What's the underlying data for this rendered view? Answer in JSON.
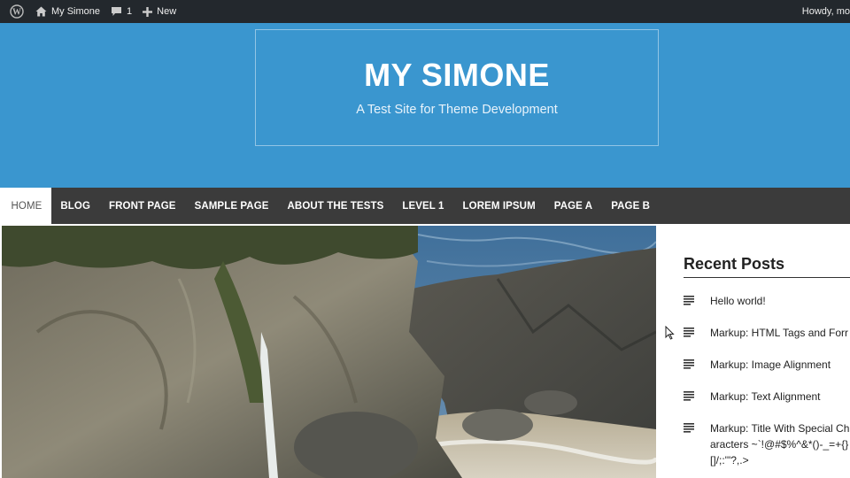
{
  "admin_bar": {
    "site_name": "My Simone",
    "comments_count": "1",
    "new_label": "New",
    "howdy": "Howdy, mo"
  },
  "header": {
    "site_title": "MY SIMONE",
    "tagline": "A Test Site for Theme Development",
    "background_color": "#3a96cf"
  },
  "nav": {
    "items": [
      {
        "label": "HOME",
        "active": true
      },
      {
        "label": "BLOG"
      },
      {
        "label": "FRONT PAGE"
      },
      {
        "label": "SAMPLE PAGE"
      },
      {
        "label": "ABOUT THE TESTS"
      },
      {
        "label": "LEVEL 1"
      },
      {
        "label": "LOREM IPSUM"
      },
      {
        "label": "PAGE A"
      },
      {
        "label": "PAGE B"
      }
    ]
  },
  "sidebar": {
    "widget_title": "Recent Posts",
    "posts": [
      {
        "title": "Hello world!"
      },
      {
        "title": "Markup: HTML Tags and Forr"
      },
      {
        "title": "Markup: Image Alignment"
      },
      {
        "title": "Markup: Text Alignment"
      },
      {
        "title": "Markup: Title With Special Characters ~`!@#$%^&*()-_=+{}[]/;:'\"?,.>"
      }
    ]
  },
  "icons": [
    "wordpress-logo-icon",
    "home-icon",
    "comment-icon",
    "plus-icon",
    "post-list-icon",
    "mouse-cursor-icon"
  ]
}
